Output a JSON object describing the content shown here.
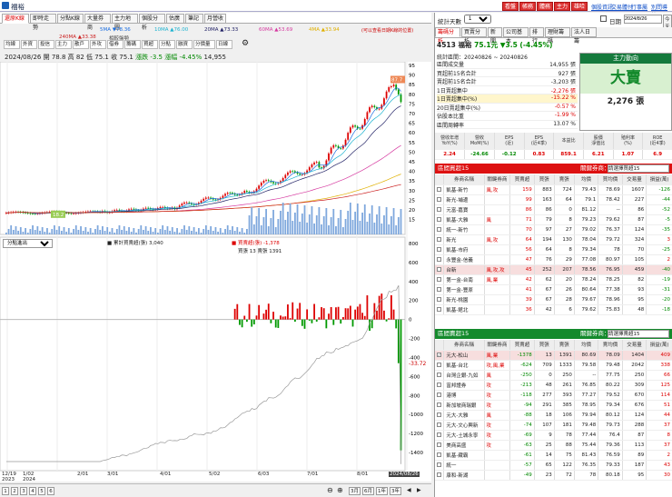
{
  "window": {
    "title": "福裕"
  },
  "top_buttons": [
    {
      "label": "看盤",
      "color": "#d33"
    },
    {
      "label": "帳務",
      "color": "#d33"
    },
    {
      "label": "體務",
      "color": "#d33"
    },
    {
      "label": "主力",
      "color": "#d33"
    },
    {
      "label": "雄哈",
      "color": "#d33"
    }
  ],
  "top_links": [
    "個股資訊",
    "交易體付",
    "行事屬",
    "別問導線"
  ],
  "tabs": [
    "還原K線",
    "即時走勢",
    "分點K線",
    "大量券商",
    "主力地圖",
    "個股分析",
    "估廣",
    "筆記",
    "月營收"
  ],
  "indicators": [
    {
      "label": "5MA ▼78.36",
      "color": "#1d6fe0"
    },
    {
      "label": "10MA ▲76.00",
      "color": "#1db3d0"
    },
    {
      "label": "20MA ▲73.33",
      "color": "#222266"
    },
    {
      "label": "60MA ▲53.69",
      "color": "#d63aa0"
    },
    {
      "label": "4MA ▲33.94",
      "color": "#e0b000"
    },
    {
      "label": "240MA ▲33.38",
      "color": "#cc2222"
    },
    {
      "label": "相較盤勢",
      "color": "#444"
    },
    {
      "label": "相較盤勢",
      "color": "#c00"
    }
  ],
  "price_note": "(可以查看日期K線的位置)",
  "subtabs": [
    "均線",
    "外資",
    "投信",
    "主力",
    "散戶",
    "外攻",
    "借券",
    "籌碼",
    "買超",
    "分點",
    "融資",
    "分價量",
    "日線"
  ],
  "ohlc": {
    "date": "2024/08/26",
    "open_label": "開 78.8",
    "high_label": "高 82",
    "low_label": "低 75.1",
    "close_label": "收 75.1",
    "chg_label": "漲跌 -3.5",
    "pct_label": "漲幅 -4.45%",
    "vol": "14,955"
  },
  "price_axis": [
    "95",
    "90",
    "85",
    "80",
    "75",
    "70",
    "65",
    "60",
    "55",
    "50",
    "45",
    "40",
    "35",
    "30",
    "25",
    "20",
    "15"
  ],
  "last_price_tag": "87.7",
  "low_tag": "18.2",
  "lower": {
    "select": "分點進出",
    "legend1": "■ 累計買賣超(張) 3,040",
    "legend2": "■ 買賣超(張) -1,378",
    "legend3": "買張 13 賣張 1391",
    "axis": [
      "800",
      "600",
      "400",
      "200",
      "0",
      "-200",
      "-400",
      "-600",
      "-800",
      "-1000",
      "-1200",
      "-1400"
    ],
    "tag": "-33.72"
  },
  "xaxis": [
    "12/19\n2023",
    "1/02\n2024",
    "2/01",
    "3/01",
    "4/01",
    "5/02",
    "6/03",
    "7/01",
    "8/01",
    "2024/08/26"
  ],
  "bottom": {
    "pages": [
      "1",
      "2",
      "3",
      "4",
      "5",
      "6"
    ],
    "ranges": [
      "3月",
      "6月",
      "1年",
      "3年"
    ]
  },
  "right": {
    "date_label": "日期",
    "date_value": "2024/8/26",
    "today_label": "今天",
    "days_label": "統計天數",
    "days_value": "1",
    "tabs": [
      "籌碼分析",
      "買賣分析",
      "新聞",
      "公司基本",
      "排行",
      "理財籌碼",
      "法人日籌"
    ],
    "stock": {
      "code_name": "4513 福裕",
      "price": "75.1元",
      "chg": "▼3.5 (-4.45%)"
    },
    "stats_title": "統計區間：20240826 ~ 20240826",
    "stats": [
      [
        "區間成交量",
        "14,955 張",
        ""
      ],
      [
        "買超前15名合計",
        "927 張",
        ""
      ],
      [
        "賣超前15名合計",
        "-3,203 張",
        ""
      ],
      [
        "1日賣超集中",
        "-2,276 張",
        "red"
      ],
      [
        "1日賣超集中(%)",
        "-15.22 %",
        "red"
      ],
      [
        "20日賣超集中(%)",
        "-0.57 %",
        "red"
      ],
      [
        "佔股本比重",
        "-1.99 %",
        "red"
      ],
      [
        "區間周轉率",
        "13.07 %",
        ""
      ]
    ],
    "power": {
      "head": "主力動向",
      "main": "大賣",
      "sub": "2,276 張"
    },
    "fund_headers": [
      "營收年增\nYoY(%)",
      "營收\nMoM(%)",
      "EPS\n(近)",
      "EPS\n(近4季)",
      "本益比",
      "股價\n淨值比",
      "殖利率\n(%)",
      "ROE\n(近4季)"
    ],
    "fund_values": [
      "2.24",
      "-24.66",
      "-0.12",
      "0.83",
      "859.1",
      "6.21",
      "1.07",
      "6.9"
    ],
    "buy": {
      "title": "區間買超15",
      "key": "關鍵券商：",
      "select": "請選擇買超15",
      "headers": [
        "",
        "券商名稱",
        "關鍵券商",
        "買賣超",
        "買張",
        "賣張",
        "均價",
        "買均價",
        "交易量",
        "損益(萬)"
      ],
      "rows": [
        [
          "",
          "凱基-新竹",
          "風,攻",
          "159",
          "883",
          "724",
          "79.43",
          "78.69",
          "1607",
          "-126"
        ],
        [
          "",
          "新光-埔邊",
          "",
          "99",
          "163",
          "64",
          "79.1",
          "78.42",
          "227",
          "-44"
        ],
        [
          "",
          "元富-嘉寶",
          "",
          "86",
          "86",
          "0",
          "81.12",
          "--",
          "86",
          "-52"
        ],
        [
          "",
          "凱基-大雅",
          "風",
          "71",
          "79",
          "8",
          "79.23",
          "79.62",
          "87",
          "-5"
        ],
        [
          "",
          "統一-新竹",
          "",
          "70",
          "97",
          "27",
          "79.02",
          "76.37",
          "124",
          "-35"
        ],
        [
          "",
          "新光",
          "風,攻",
          "64",
          "194",
          "130",
          "78.04",
          "79.72",
          "324",
          "3"
        ],
        [
          "",
          "凱基-市府",
          "",
          "56",
          "64",
          "8",
          "79.34",
          "78",
          "70",
          "-25"
        ],
        [
          "",
          "永豐金-信義",
          "",
          "47",
          "76",
          "29",
          "77.08",
          "80.97",
          "105",
          "2"
        ],
        [
          "",
          "台新",
          "風,攻,攻",
          "45",
          "252",
          "207",
          "78.56",
          "76.95",
          "459",
          "-40"
        ],
        [
          "",
          "第一金-台南",
          "風,業",
          "42",
          "62",
          "20",
          "78.24",
          "78.25",
          "82",
          "-19"
        ],
        [
          "",
          "第一金-豐原",
          "",
          "41",
          "67",
          "26",
          "80.64",
          "77.38",
          "93",
          "-31"
        ],
        [
          "",
          "新光-桃園",
          "",
          "39",
          "67",
          "28",
          "79.67",
          "78.96",
          "95",
          "-20"
        ],
        [
          "",
          "凱基-館北",
          "",
          "36",
          "42",
          "6",
          "79.62",
          "75.83",
          "48",
          "-18"
        ]
      ]
    },
    "sell": {
      "title": "區間賣超15",
      "key": "關鍵券商：",
      "select": "請選擇賣超15",
      "headers": [
        "",
        "券商名稱",
        "關鍵券商",
        "買賣超",
        "買張",
        "賣張",
        "均價",
        "賣均價",
        "交易量",
        "損益(萬)"
      ],
      "rows": [
        [
          "✓",
          "元大-松山",
          "風,業",
          "-1378",
          "13",
          "1391",
          "80.69",
          "78.09",
          "1404",
          "409"
        ],
        [
          "",
          "凱基-台北",
          "攻,風,業",
          "-624",
          "709",
          "1333",
          "79.58",
          "79.48",
          "2042",
          "338"
        ],
        [
          "",
          "台灣企銀-九如",
          "風",
          "-250",
          "0",
          "250",
          "--",
          "77.75",
          "250",
          "66"
        ],
        [
          "",
          "富邦證券",
          "攻",
          "-213",
          "48",
          "261",
          "76.85",
          "80.22",
          "309",
          "125"
        ],
        [
          "",
          "港博",
          "攻",
          "-118",
          "277",
          "393",
          "77.27",
          "79.52",
          "670",
          "114"
        ],
        [
          "",
          "新加坡商瑞銀",
          "攻",
          "-94",
          "291",
          "385",
          "78.95",
          "79.34",
          "676",
          "51"
        ],
        [
          "",
          "元大-大雅",
          "風",
          "-88",
          "18",
          "106",
          "79.94",
          "80.12",
          "124",
          "44"
        ],
        [
          "",
          "元大-文心興新",
          "攻",
          "-74",
          "107",
          "181",
          "79.48",
          "79.73",
          "288",
          "37"
        ],
        [
          "",
          "元大-土城永寧",
          "攻",
          "-69",
          "9",
          "78",
          "77.44",
          "76.4",
          "87",
          "8"
        ],
        [
          "",
          "美商高盛",
          "攻",
          "-63",
          "25",
          "88",
          "75.44",
          "79.36",
          "113",
          "37"
        ],
        [
          "",
          "凱基-藏霸",
          "",
          "-61",
          "14",
          "75",
          "81.43",
          "76.59",
          "89",
          "2"
        ],
        [
          "",
          "統一",
          "",
          "-57",
          "65",
          "122",
          "76.35",
          "79.33",
          "187",
          "43"
        ],
        [
          "",
          "康和-新湖",
          "",
          "-49",
          "23",
          "72",
          "78",
          "80.18",
          "95",
          "30"
        ]
      ]
    }
  }
}
